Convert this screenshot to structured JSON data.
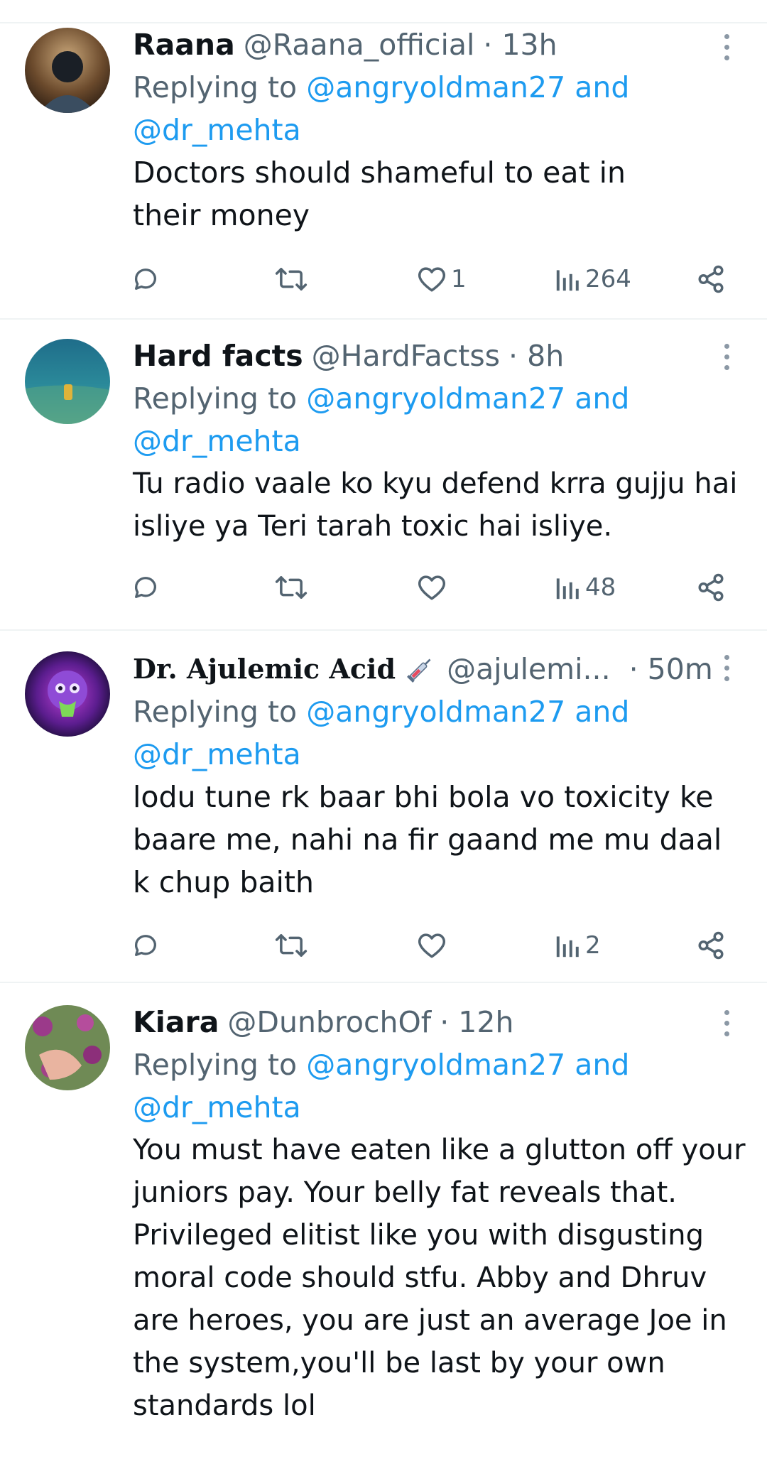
{
  "replying_label": "Replying to",
  "and_label": "and",
  "tweets": [
    {
      "name": "Raana",
      "handle": "@Raana_official",
      "time": "· 13h",
      "mention1": "@angryoldman27",
      "mention2": "@dr_mehta",
      "text": "Doctors should shameful to eat in their money",
      "likes": "1",
      "views": "264"
    },
    {
      "name": "Hard facts",
      "handle": "@HardFactss",
      "time": "· 8h",
      "mention1": "@angryoldman27",
      "mention2": "@dr_mehta",
      "text": "Tu radio vaale ko kyu defend krra gujju hai isliye ya Teri tarah toxic hai isliye.",
      "likes": "",
      "views": "48"
    },
    {
      "name": "Dr. Ajulemic Acid",
      "handle": "@ajulemi...",
      "time": "· 50m",
      "mention1": "@angryoldman27",
      "mention2": "@dr_mehta",
      "text": "lodu tune rk baar bhi bola vo toxicity ke baare me, nahi na fir gaand me mu daal k chup baith",
      "likes": "",
      "views": "2",
      "badge_icon": "syringe-icon"
    },
    {
      "name": "Kiara",
      "handle": "@DunbrochOf",
      "time": "· 12h",
      "mention1": "@angryoldman27",
      "mention2": "@dr_mehta",
      "text": "You must have eaten like a glutton off your juniors pay. Your belly fat reveals that. Privileged elitist like you with disgusting moral code should stfu. Abby and Dhruv are heroes, you are just an average Joe in the system,you'll be last by your own standards lol"
    }
  ],
  "colors": {
    "text": "#0f1419",
    "secondary": "#536471",
    "link": "#1d9bf0",
    "divider": "#eff3f4"
  }
}
